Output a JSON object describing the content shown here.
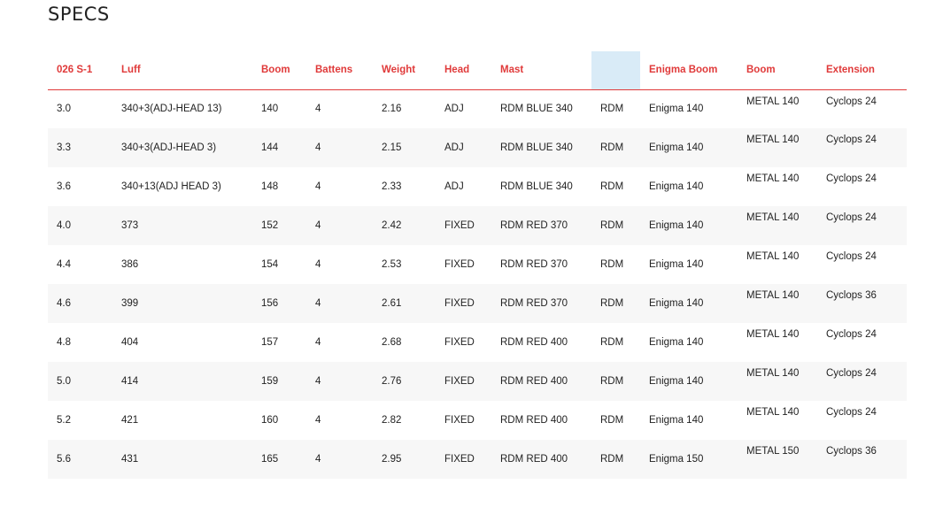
{
  "page": {
    "title": "SPECS"
  },
  "colors": {
    "header_text": "#e03a3a",
    "header_rule": "#e03a3a",
    "highlight_column": "#d9ebf7",
    "row_alt": "#f7f7f7",
    "text": "#222222"
  },
  "table": {
    "headers": [
      "026 S-1",
      "Luff",
      "Boom",
      "Battens",
      "Weight",
      "Head",
      "Mast",
      "",
      "Enigma Boom",
      "Boom",
      "Extension"
    ],
    "rows": [
      [
        "3.0",
        "340+3(ADJ-HEAD 13)",
        "140",
        "4",
        "2.16",
        "ADJ",
        "RDM BLUE 340",
        "RDM",
        "Enigma 140",
        "METAL 140",
        "Cyclops 24"
      ],
      [
        "3.3",
        "340+3(ADJ-HEAD 3)",
        "144",
        "4",
        "2.15",
        "ADJ",
        "RDM BLUE 340",
        "RDM",
        "Enigma 140",
        "METAL 140",
        "Cyclops 24"
      ],
      [
        "3.6",
        "340+13(ADJ HEAD 3)",
        "148",
        "4",
        "2.33",
        "ADJ",
        "RDM BLUE 340",
        "RDM",
        "Enigma 140",
        "METAL 140",
        "Cyclops 24"
      ],
      [
        "4.0",
        "373",
        "152",
        "4",
        "2.42",
        "FIXED",
        "RDM RED 370",
        "RDM",
        "Enigma 140",
        "METAL 140",
        "Cyclops 24"
      ],
      [
        "4.4",
        "386",
        "154",
        "4",
        "2.53",
        "FIXED",
        "RDM RED 370",
        "RDM",
        "Enigma 140",
        "METAL 140",
        "Cyclops 24"
      ],
      [
        "4.6",
        "399",
        "156",
        "4",
        "2.61",
        "FIXED",
        "RDM RED 370",
        "RDM",
        "Enigma 140",
        "METAL 140",
        "Cyclops 36"
      ],
      [
        "4.8",
        "404",
        "157",
        "4",
        "2.68",
        "FIXED",
        "RDM RED 400",
        "RDM",
        "Enigma 140",
        "METAL 140",
        "Cyclops 24"
      ],
      [
        "5.0",
        "414",
        "159",
        "4",
        "2.76",
        "FIXED",
        "RDM RED 400",
        "RDM",
        "Enigma 140",
        "METAL 140",
        "Cyclops 24"
      ],
      [
        "5.2",
        "421",
        "160",
        "4",
        "2.82",
        "FIXED",
        "RDM RED 400",
        "RDM",
        "Enigma 140",
        "METAL 140",
        "Cyclops 24"
      ],
      [
        "5.6",
        "431",
        "165",
        "4",
        "2.95",
        "FIXED",
        "RDM RED 400",
        "RDM",
        "Enigma 150",
        "METAL 150",
        "Cyclops 36"
      ]
    ]
  }
}
